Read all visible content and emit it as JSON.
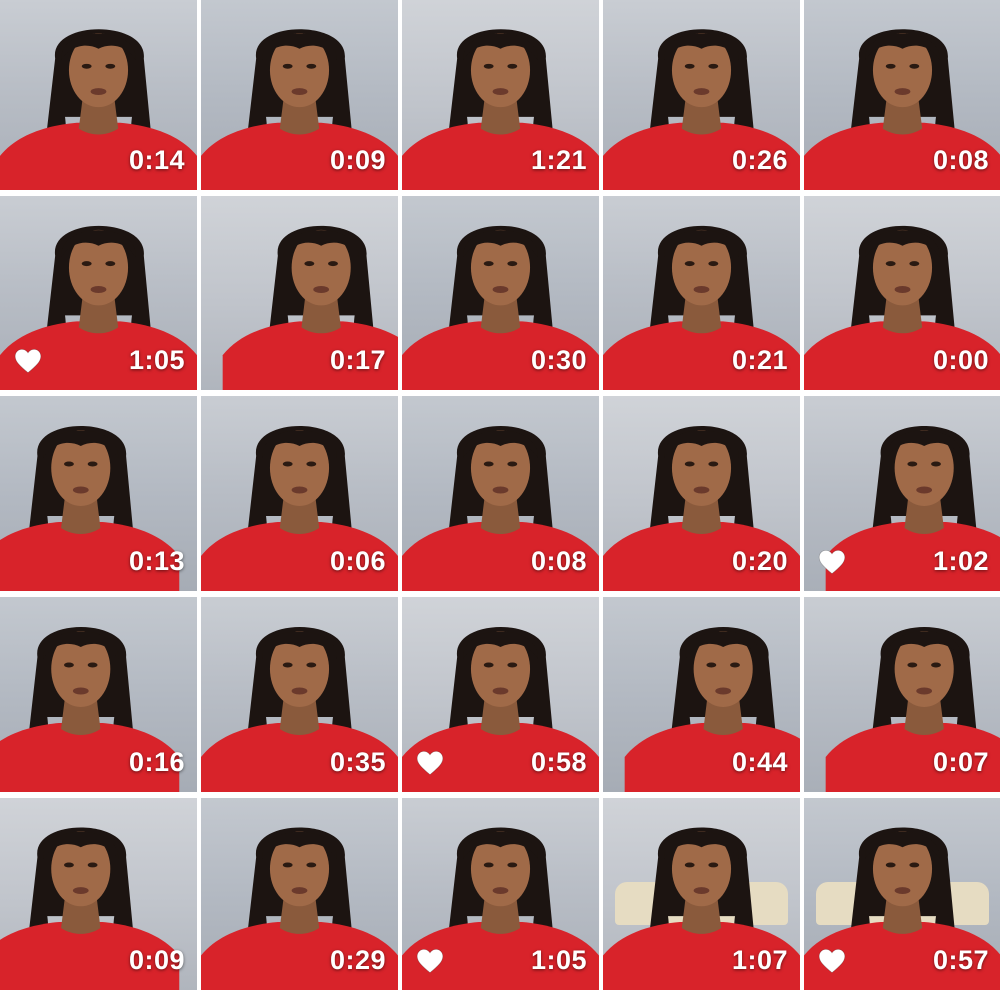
{
  "colors": {
    "sweater": "#d8232a",
    "sweater_dark": "#b41a20",
    "hair": "#1c1411",
    "skin": "#8a5a3c",
    "skin_light": "#a06a48",
    "overlay_text": "#ffffff"
  },
  "tiles": [
    {
      "duration": "0:14",
      "favorite": false,
      "bg": "variant-a",
      "pose": "center",
      "cushion": false
    },
    {
      "duration": "0:09",
      "favorite": false,
      "bg": "variant-b",
      "pose": "center",
      "cushion": false
    },
    {
      "duration": "1:21",
      "favorite": false,
      "bg": "variant-c",
      "pose": "center",
      "cushion": false
    },
    {
      "duration": "0:26",
      "favorite": false,
      "bg": "variant-a",
      "pose": "center",
      "cushion": false
    },
    {
      "duration": "0:08",
      "favorite": false,
      "bg": "variant-b",
      "pose": "center",
      "cushion": false
    },
    {
      "duration": "1:05",
      "favorite": true,
      "bg": "variant-a",
      "pose": "center",
      "cushion": false
    },
    {
      "duration": "0:17",
      "favorite": false,
      "bg": "variant-c",
      "pose": "right",
      "cushion": false
    },
    {
      "duration": "0:30",
      "favorite": false,
      "bg": "variant-b",
      "pose": "center",
      "cushion": false
    },
    {
      "duration": "0:21",
      "favorite": false,
      "bg": "variant-a",
      "pose": "center",
      "cushion": false
    },
    {
      "duration": "0:00",
      "favorite": false,
      "bg": "variant-c",
      "pose": "center",
      "cushion": false
    },
    {
      "duration": "0:13",
      "favorite": false,
      "bg": "variant-b",
      "pose": "left",
      "cushion": false
    },
    {
      "duration": "0:06",
      "favorite": false,
      "bg": "variant-a",
      "pose": "center",
      "cushion": false
    },
    {
      "duration": "0:08",
      "favorite": false,
      "bg": "variant-b",
      "pose": "center",
      "cushion": false
    },
    {
      "duration": "0:20",
      "favorite": false,
      "bg": "variant-c",
      "pose": "center",
      "cushion": false
    },
    {
      "duration": "1:02",
      "favorite": true,
      "bg": "variant-a",
      "pose": "right",
      "cushion": false
    },
    {
      "duration": "0:16",
      "favorite": false,
      "bg": "variant-b",
      "pose": "left",
      "cushion": false
    },
    {
      "duration": "0:35",
      "favorite": false,
      "bg": "variant-a",
      "pose": "center",
      "cushion": false
    },
    {
      "duration": "0:58",
      "favorite": true,
      "bg": "variant-c",
      "pose": "center",
      "cushion": false
    },
    {
      "duration": "0:44",
      "favorite": false,
      "bg": "variant-b",
      "pose": "right",
      "cushion": false
    },
    {
      "duration": "0:07",
      "favorite": false,
      "bg": "variant-a",
      "pose": "right",
      "cushion": false
    },
    {
      "duration": "0:09",
      "favorite": false,
      "bg": "variant-c",
      "pose": "left",
      "cushion": false
    },
    {
      "duration": "0:29",
      "favorite": false,
      "bg": "variant-b",
      "pose": "center",
      "cushion": false
    },
    {
      "duration": "1:05",
      "favorite": true,
      "bg": "variant-a",
      "pose": "center",
      "cushion": false
    },
    {
      "duration": "1:07",
      "favorite": false,
      "bg": "variant-c",
      "pose": "center",
      "cushion": true
    },
    {
      "duration": "0:57",
      "favorite": true,
      "bg": "variant-b",
      "pose": "center",
      "cushion": true
    }
  ]
}
